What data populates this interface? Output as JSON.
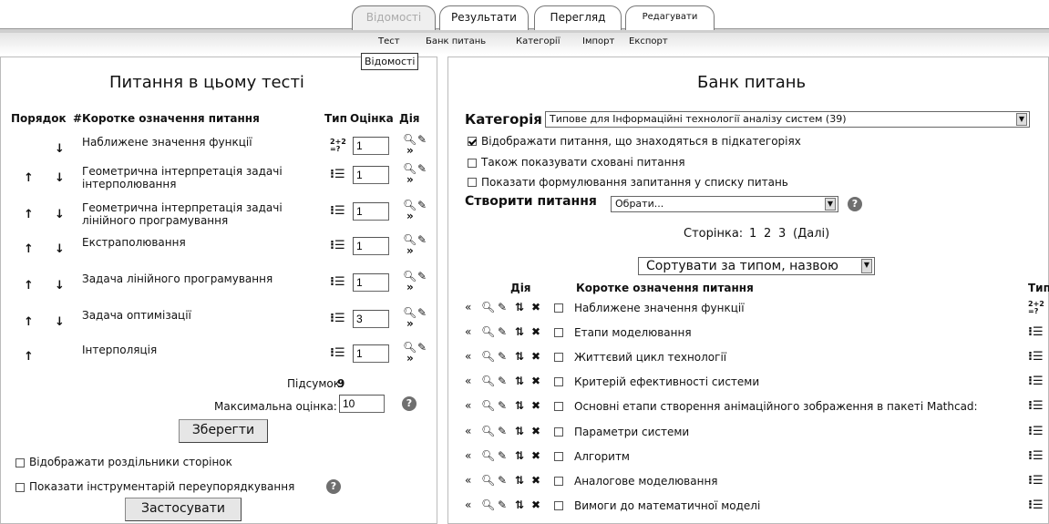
{
  "tabs": {
    "details": "Відомості",
    "results": "Результати",
    "preview": "Перегляд",
    "edit": "Редагувати"
  },
  "subtabs": [
    "Тест",
    "Банк питань",
    "Категорії",
    "Імпорт",
    "Експорт"
  ],
  "tooltip": "Відомості",
  "left": {
    "title": "Питання в цьому тесті",
    "headers": {
      "order": "Порядок",
      "hash": "#",
      "name": "Коротке означення питання",
      "type": "Тип",
      "grade": "Оцінка",
      "action": "Дія"
    },
    "questions": [
      {
        "name": "Наближене значення функції",
        "grade": "1",
        "up": false,
        "down": true
      },
      {
        "name": "Геометрична інтерпретація задачі інтерполювання",
        "grade": "1",
        "up": true,
        "down": true
      },
      {
        "name": "Геометрична інтерпретація задачі лінійного програмування",
        "grade": "1",
        "up": true,
        "down": true
      },
      {
        "name": "Екстраполювання",
        "grade": "1",
        "up": true,
        "down": true
      },
      {
        "name": "Задача лінійного програмування",
        "grade": "1",
        "up": true,
        "down": true
      },
      {
        "name": "Задача оптимізації",
        "grade": "3",
        "up": true,
        "down": true
      },
      {
        "name": "Інтерполяція",
        "grade": "1",
        "up": true,
        "down": false
      }
    ],
    "total_label": "Підсумок:",
    "total_value": "9",
    "max_label": "Максимальна оцінка:",
    "max_value": "10",
    "save": "Зберегти",
    "show_breaks": "Відображати роздільники сторінок",
    "reorder_tool": "Показати інструментарій переупорядкування",
    "apply": "Застосувати"
  },
  "right": {
    "title": "Банк питань",
    "category_label": "Категорія",
    "category_value": "Типове для Інформаційні технології аналізу систем (39)",
    "opt_subcats": "Відображати питання, що знаходяться в підкатегоріях",
    "opt_hidden": "Також показувати сховані питання",
    "opt_text": "Показати формулювання запитання у списку питань",
    "create_label": "Створити питання",
    "create_value": "Обрати...",
    "pages_label": "Сторінка:",
    "pages": [
      "1",
      "2",
      "3"
    ],
    "next": "(Далі)",
    "sort": "Сортувати за типом, назвою",
    "col_action": "Дія",
    "col_name": "Коротке означення питання",
    "col_type": "Тип",
    "questions": [
      "Наближене значення функції",
      "Етапи моделювання",
      "Життєвий цикл технології",
      "Критерій ефективності системи",
      "Основні етапи створення анімаційного зображення в пакеті Mathcad:",
      "Параметри системи",
      "Алгоритм",
      "Аналогове моделювання",
      "Вимоги до математичної моделі"
    ]
  }
}
